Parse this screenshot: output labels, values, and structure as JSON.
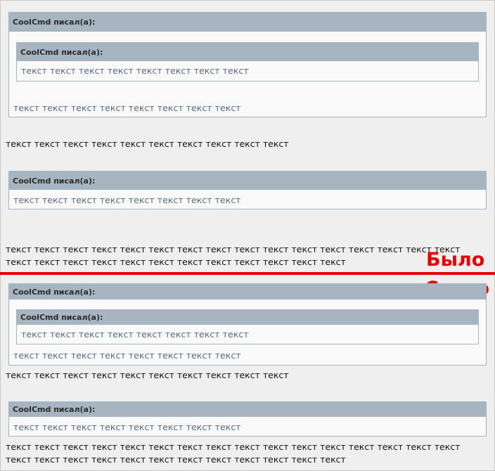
{
  "before": {
    "outer_quote": {
      "author": "CoolCmd писал(а):",
      "inner_quote": {
        "author": "CoolCmd писал(а):",
        "text": "текст текст текст текст текст текст текст текст"
      },
      "text": "текст текст текст текст текст текст текст текст"
    },
    "text_1": "текст текст текст текст текст текст текст текст текст текст",
    "single_quote": {
      "author": "CoolCmd писал(а):",
      "text": "текст текст текст текст текст текст текст текст"
    },
    "text_2_line1": "текст текст текст текст текст текст текст текст текст текст текст текст текст текст текст текст",
    "text_2_line2": "текст текст текст текст текст текст текст текст текст текст текст текст"
  },
  "label_before": "Было",
  "label_after": "Стало",
  "after": {
    "outer_quote": {
      "author": "CoolCmd писал(а):",
      "inner_quote": {
        "author": "CoolCmd писал(а):",
        "text": "текст текст текст текст текст текст текст текст"
      },
      "text": "текст текст текст текст текст текст текст текст"
    },
    "text_1": "текст текст текст текст текст текст текст текст текст текст",
    "single_quote": {
      "author": "CoolCmd писал(а):",
      "text": "текст текст текст текст текст текст текст текст"
    },
    "text_2_line1": "текст текст текст текст текст текст текст текст текст текст текст текст текст текст текст текст",
    "text_2_line2": "текст текст текст текст текст текст текст текст текст текст текст текст"
  },
  "colors": {
    "accent_red": "#e50000",
    "quote_header": "#a7b5c1",
    "quote_border": "#a7b4c0",
    "quote_text": "#596a80"
  }
}
